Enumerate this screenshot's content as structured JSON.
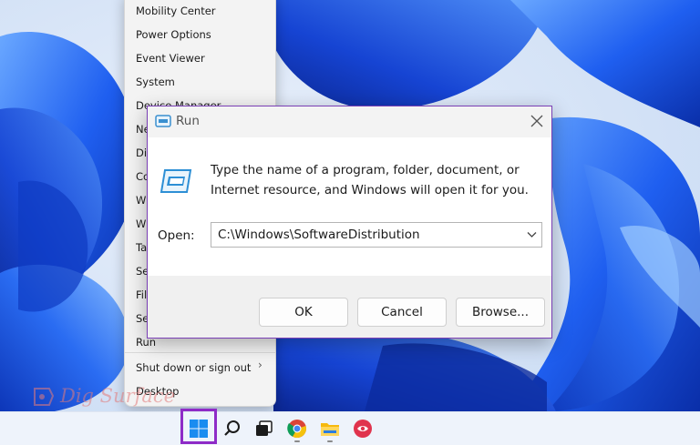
{
  "winx_menu": {
    "items": [
      {
        "label": "Mobility Center"
      },
      {
        "label": "Power Options"
      },
      {
        "label": "Event Viewer"
      },
      {
        "label": "System"
      },
      {
        "label": "Device Manager"
      },
      {
        "label": "Ne"
      },
      {
        "label": "Dis"
      },
      {
        "label": "Co"
      },
      {
        "label": "Wi"
      },
      {
        "label": "Wi"
      },
      {
        "label": "Tas"
      },
      {
        "label": "Set"
      },
      {
        "label": "File"
      },
      {
        "label": "Sea"
      },
      {
        "label": "Run"
      },
      {
        "label": "Shut down or sign out"
      },
      {
        "label": "Desktop"
      }
    ]
  },
  "run_dialog": {
    "title": "Run",
    "description_line1": "Type the name of a program, folder, document, or",
    "description_line2": "Internet resource, and Windows will open it for you.",
    "open_label": "Open:",
    "open_value": "C:\\Windows\\SoftwareDistribution",
    "ok_label": "OK",
    "cancel_label": "Cancel",
    "browse_label": "Browse..."
  },
  "taskbar": {
    "icons": [
      "windows-start-icon",
      "search-icon",
      "task-view-icon",
      "chrome-icon",
      "file-explorer-icon",
      "app-icon"
    ]
  },
  "watermark": {
    "text": "Dig Surface"
  },
  "colors": {
    "accent": "#8e2bc7",
    "dialog_border": "#7a3fb5",
    "wallpaper_blue": "#1a5ae0"
  }
}
